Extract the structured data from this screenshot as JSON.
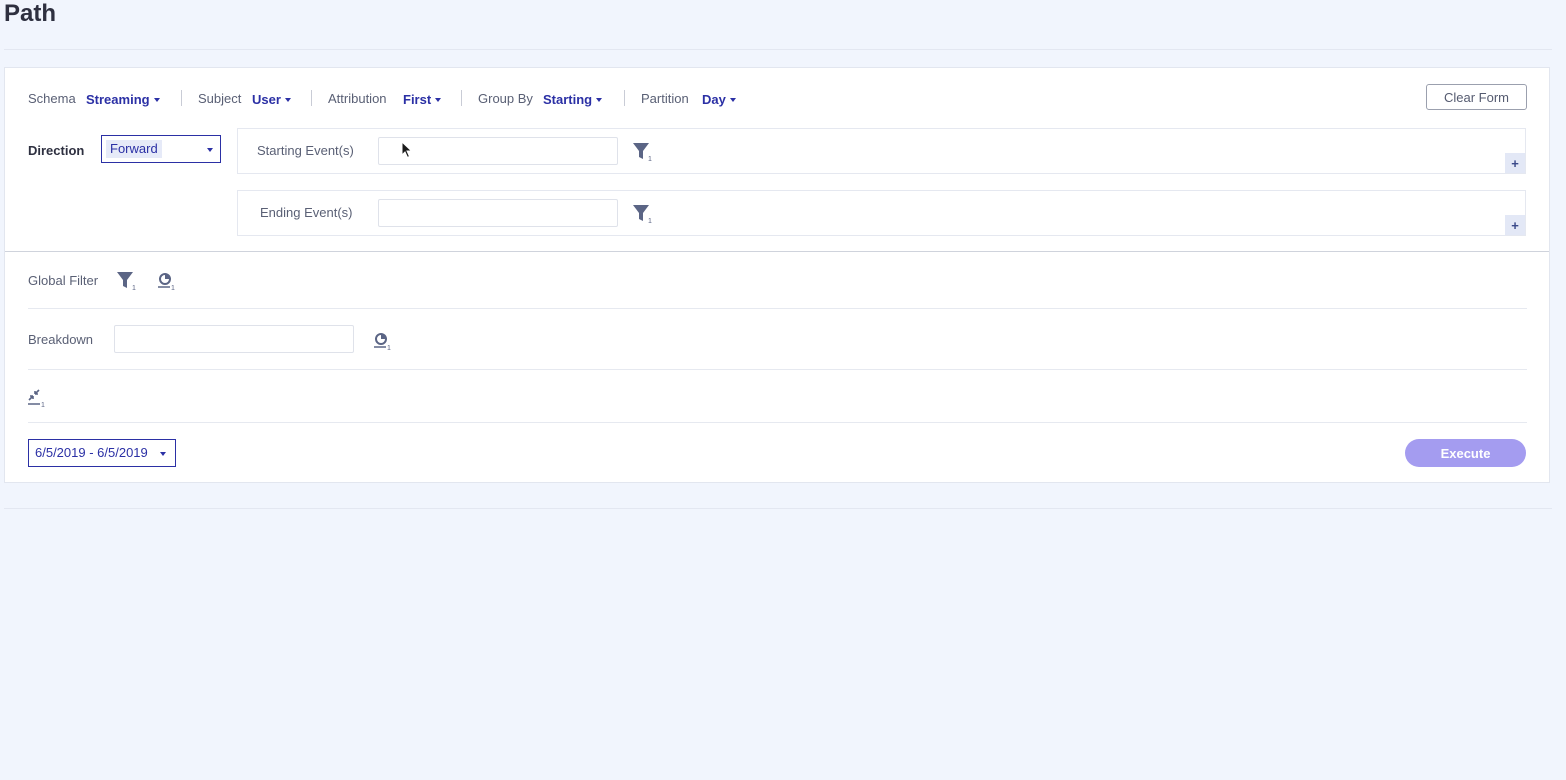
{
  "page": {
    "title": "Path"
  },
  "toolbar": {
    "schema": {
      "label": "Schema",
      "value": "Streaming"
    },
    "subject": {
      "label": "Subject",
      "value": "User"
    },
    "attribution": {
      "label": "Attribution",
      "value": "First"
    },
    "group_by": {
      "label": "Group By",
      "value": "Starting"
    },
    "partition": {
      "label": "Partition",
      "value": "Day"
    },
    "clear_form_label": "Clear Form"
  },
  "direction": {
    "label": "Direction",
    "value": "Forward"
  },
  "events": {
    "starting": {
      "label": "Starting Event(s)",
      "value": "",
      "add_label": "+"
    },
    "ending": {
      "label": "Ending Event(s)",
      "value": "",
      "add_label": "+"
    }
  },
  "global_filter": {
    "label": "Global Filter"
  },
  "breakdown": {
    "label": "Breakdown",
    "value": ""
  },
  "date_range": {
    "value": "6/5/2019 - 6/5/2019"
  },
  "execute_label": "Execute",
  "icons": {
    "filter": "filter-icon",
    "segment": "segment-icon",
    "collapse": "collapse-arrows-icon",
    "cursor": "mouse-cursor-icon"
  },
  "colors": {
    "accent": "#2b30a5",
    "execute_button": "#a49cf0",
    "icon": "#5b6585",
    "background": "#f1f5fd"
  }
}
